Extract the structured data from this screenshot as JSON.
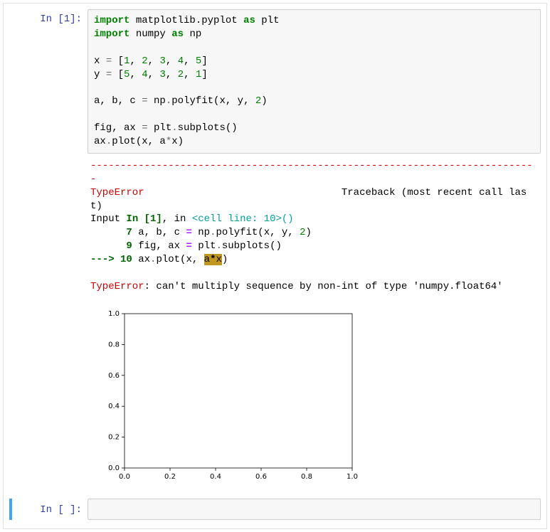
{
  "cell1": {
    "prompt": "In [1]:",
    "code": {
      "l1a": "import",
      "l1b": " matplotlib.pyplot ",
      "l1c": "as",
      "l1d": " plt",
      "l2a": "import",
      "l2b": " numpy ",
      "l2c": "as",
      "l2d": " np",
      "l4a": "x ",
      "l4b": "=",
      "l4c": " [",
      "l4d": "1",
      "l4e": ", ",
      "l4f": "2",
      "l4g": ", ",
      "l4h": "3",
      "l4i": ", ",
      "l4j": "4",
      "l4k": ", ",
      "l4l": "5",
      "l4m": "]",
      "l5a": "y ",
      "l5b": "=",
      "l5c": " [",
      "l5d": "5",
      "l5e": ", ",
      "l5f": "4",
      "l5g": ", ",
      "l5h": "3",
      "l5i": ", ",
      "l5j": "2",
      "l5k": ", ",
      "l5l": "1",
      "l5m": "]",
      "l7a": "a, b, c ",
      "l7b": "=",
      "l7c": " np",
      "l7d": ".",
      "l7e": "polyfit(x, y, ",
      "l7f": "2",
      "l7g": ")",
      "l9a": "fig, ax ",
      "l9b": "=",
      "l9c": " plt",
      "l9d": ".",
      "l9e": "subplots()",
      "l10a": "ax",
      "l10b": ".",
      "l10c": "plot(x, a",
      "l10d": "*",
      "l10e": "x)"
    },
    "tb": {
      "dashes": "---------------------------------------------------------------------------",
      "errname": "TypeError",
      "tbhdr": "                                 Traceback (most recent call last)",
      "inputln_a": "Input ",
      "inputln_b": "In [1]",
      "inputln_c": ", in ",
      "inputln_d": "<cell line: 10>",
      "inputln_e": "()",
      "ln7a": "      7",
      "ln7b": " a, b, c ",
      "ln7c": "=",
      "ln7d": " np",
      "ln7e": ".",
      "ln7f": "polyfit(x, y, ",
      "ln7g": "2",
      "ln7h": ")",
      "ln9a": "      9",
      "ln9b": " fig, ax ",
      "ln9c": "=",
      "ln9d": " plt",
      "ln9e": ".",
      "ln9f": "subplots()",
      "ln10a": "---> 10",
      "ln10b": " ax",
      "ln10c": ".",
      "ln10d": "plot(x, ",
      "ln10e": "a",
      "ln10f": "*",
      "ln10g": "x",
      "ln10h": ")",
      "finala": "TypeError",
      "finalb": ": can't multiply sequence by non-int of type 'numpy.float64'"
    }
  },
  "cell2": {
    "prompt": "In [ ]:"
  },
  "chart_data": {
    "type": "line",
    "title": "",
    "xlabel": "",
    "ylabel": "",
    "xlim": [
      0.0,
      1.0
    ],
    "ylim": [
      0.0,
      1.0
    ],
    "xticks": [
      0.0,
      0.2,
      0.4,
      0.6,
      0.8,
      1.0
    ],
    "yticks": [
      0.0,
      0.2,
      0.4,
      0.6,
      0.8,
      1.0
    ],
    "series": []
  }
}
